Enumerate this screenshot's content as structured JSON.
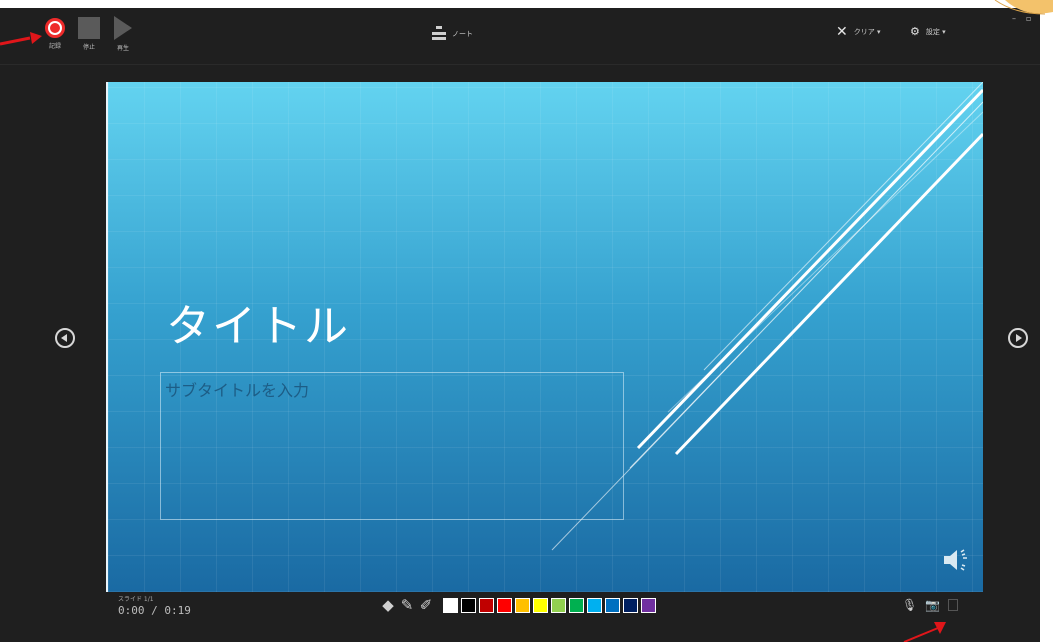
{
  "toolbar": {
    "record_label": "記録",
    "stop_label": "停止",
    "play_label": "再生",
    "notes_label": "ノート",
    "clear_label": "クリア ▾",
    "settings_label": "設定 ▾",
    "window_minimize": "–",
    "window_restore": "▫"
  },
  "slide": {
    "title": "タイトル",
    "subtitle_placeholder": "サブタイトルを入力"
  },
  "footer": {
    "slide_number": "スライド 1/1",
    "timer": "0:00 / 0:19"
  },
  "pen_tools": {
    "icons": [
      "eraser-icon",
      "pen-icon",
      "highlighter-icon"
    ],
    "colors": [
      "#ffffff",
      "#000000",
      "#c00000",
      "#ff0000",
      "#ffc000",
      "#ffff00",
      "#92d050",
      "#00b050",
      "#00b0f0",
      "#0070c0",
      "#002060",
      "#7030a0"
    ]
  },
  "media_tools": [
    "microphone-icon",
    "camera-icon",
    "camera-preview-icon"
  ],
  "accent": {
    "record": "#ee2b2b",
    "annotation_arrow": "#e0161a"
  }
}
